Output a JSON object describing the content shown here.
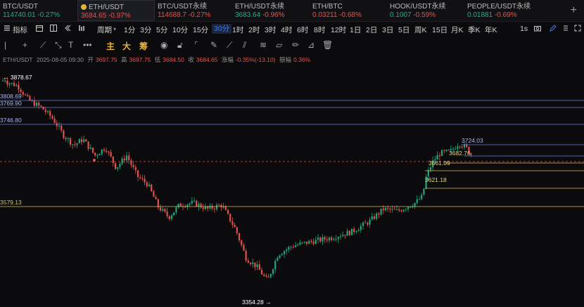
{
  "tickers": [
    {
      "name": "BTC/USDT",
      "price": "114740.01",
      "change": "-0.27%",
      "price_color": "up",
      "change_color": "up",
      "active": false
    },
    {
      "name": "ETH/USDT",
      "price": "3684.65",
      "change": "-0.97%",
      "price_color": "dn",
      "change_color": "dn",
      "active": true
    },
    {
      "name": "BTC/USDT永续",
      "price": "114688.7",
      "change": "-0.27%",
      "price_color": "dn",
      "change_color": "dn",
      "active": false
    },
    {
      "name": "ETH/USDT永续",
      "price": "3683.64",
      "change": "-0.96%",
      "price_color": "up",
      "change_color": "dn",
      "active": false
    },
    {
      "name": "ETH/BTC",
      "price": "0.03211",
      "change": "-0.68%",
      "price_color": "dn",
      "change_color": "dn",
      "active": false
    },
    {
      "name": "HOOK/USDT永续",
      "price": "0.1007",
      "change": "-0.59%",
      "price_color": "up",
      "change_color": "dn",
      "active": false
    },
    {
      "name": "PEOPLE/USDT永续",
      "price": "0.01881",
      "change": "-0.69%",
      "price_color": "up",
      "change_color": "dn",
      "active": false
    }
  ],
  "add_tab": "+",
  "toolbar": {
    "indicator": "指标",
    "period": "周期",
    "intervals": [
      "1分",
      "3分",
      "5分",
      "10分",
      "15分",
      "30分",
      "1时",
      "2时",
      "3时",
      "4时",
      "6时",
      "8时",
      "12时",
      "1日",
      "2日",
      "3日",
      "5日",
      "周K",
      "15日",
      "月K",
      "季K",
      "年K"
    ],
    "active_interval": "30分",
    "mode": "1s"
  },
  "drawbar": {
    "tools": [
      "主",
      "大",
      "筹"
    ]
  },
  "info": {
    "symbol": "ETH/USDT",
    "datetime": "2025-08-05 09:30",
    "open_label": "开",
    "open": "3697.75",
    "high_label": "高",
    "high": "3697.75",
    "low_label": "低",
    "low": "3684.50",
    "close_label": "收",
    "close": "3684.65",
    "change_label": "涨幅",
    "change": "-0.35%(-13.10)",
    "amp_label": "振幅",
    "amp": "0.36%"
  },
  "chart_data": {
    "type": "candlestick",
    "high_label": "← 3878.67",
    "low_label": "3354.28 →",
    "horizontal_levels": [
      {
        "label": "3808.69",
        "color": "#6d7fd8"
      },
      {
        "label": "3769.90",
        "color": "#6d7fd8"
      },
      {
        "label": "3746.80",
        "color": "#6d7fd8"
      },
      {
        "label": "3724.03",
        "color": "#6d7fd8"
      },
      {
        "label": "3579.13",
        "color": "#d8c25a"
      }
    ],
    "annotations": [
      "3682.76",
      "3661.09",
      "3621.18"
    ],
    "current_price_line": "3684.65",
    "colors": {
      "up": "#1fa67a",
      "down": "#e0514d"
    }
  }
}
